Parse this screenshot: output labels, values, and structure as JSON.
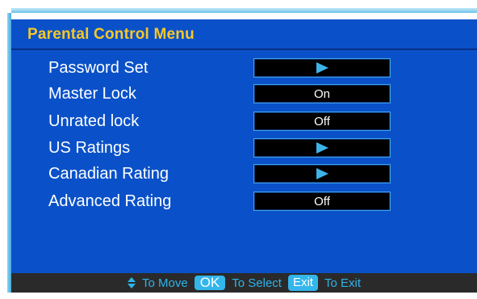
{
  "menu": {
    "title": "Parental Control Menu",
    "items": [
      {
        "label": "Password Set",
        "value": "",
        "icon": "arrow-right"
      },
      {
        "label": "Master Lock",
        "value": "On",
        "icon": ""
      },
      {
        "label": "Unrated lock",
        "value": "Off",
        "icon": ""
      },
      {
        "label": "US Ratings",
        "value": "",
        "icon": "arrow-right"
      },
      {
        "label": "Canadian Rating",
        "value": "",
        "icon": "arrow-right"
      },
      {
        "label": "Advanced Rating",
        "value": "Off",
        "icon": ""
      }
    ]
  },
  "footer": {
    "move_text": "To Move",
    "ok_key": "OK",
    "select_text": "To Select",
    "exit_key": "Exit",
    "exit_text": "To Exit"
  },
  "colors": {
    "panel": "#0a51c9",
    "title": "#f7c72a",
    "accent": "#33b6ec",
    "footer": "#2a2a2a"
  }
}
